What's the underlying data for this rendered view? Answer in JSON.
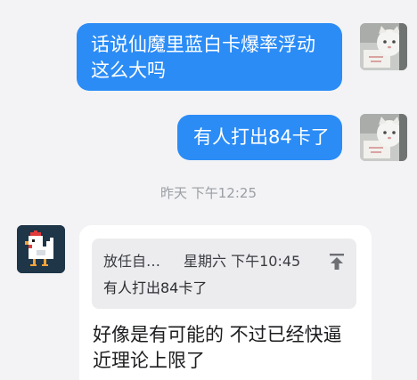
{
  "messages": {
    "outgoing_1": "话说仙魔里蓝白卡爆率浮动这么大吗",
    "outgoing_2": "有人打出84卡了",
    "timestamp": "昨天 下午12:25",
    "incoming": {
      "quote": {
        "sender": "放任自…",
        "time": "星期六 下午10:45",
        "text": "有人打出84卡了",
        "jump_icon": "jump-to-original-icon"
      },
      "text": "好像是有可能的  不过已经快逼近理论上限了"
    }
  },
  "avatars": {
    "self": "cat-photo-avatar",
    "other": "pixel-chicken-avatar"
  },
  "colors": {
    "background": "#f3f3f5",
    "outgoing_bubble": "#2b8cf6",
    "incoming_bubble": "#ffffff",
    "quote_card": "#ececef",
    "timestamp": "#9a9ea3"
  }
}
